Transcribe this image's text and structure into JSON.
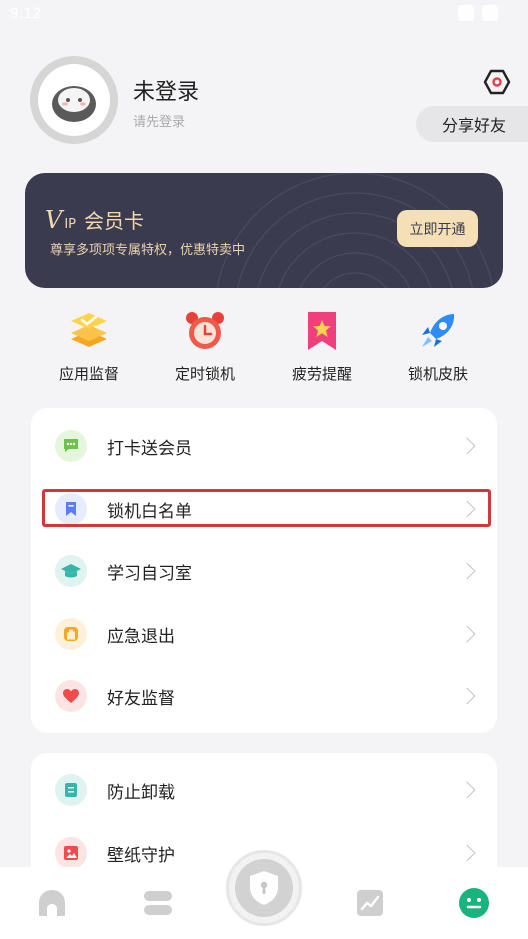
{
  "status_bar": {
    "time": "9:12"
  },
  "profile": {
    "name": "未登录",
    "subtitle": "请先登录",
    "share_label": "分享好友"
  },
  "vip": {
    "v_letter": "V",
    "ip_letters": "IP",
    "title": "会员卡",
    "description": "尊享多项项专属特权，优惠特卖中",
    "button_label": "立即开通"
  },
  "quick_actions": [
    {
      "label": "应用监督",
      "icon": "layers-icon"
    },
    {
      "label": "定时锁机",
      "icon": "alarm-clock-icon"
    },
    {
      "label": "疲劳提醒",
      "icon": "bookmark-star-icon"
    },
    {
      "label": "锁机皮肤",
      "icon": "rocket-icon"
    }
  ],
  "menu_group_1": [
    {
      "label": "打卡送会员",
      "icon": "chat-icon",
      "color": "#6cc24a"
    },
    {
      "label": "锁机白名单",
      "icon": "bookmark-icon",
      "color": "#5b7cf2"
    },
    {
      "label": "学习自习室",
      "icon": "graduation-cap-icon",
      "color": "#36b5a8"
    },
    {
      "label": "应急退出",
      "icon": "hand-icon",
      "color": "#f5a623"
    },
    {
      "label": "好友监督",
      "icon": "heart-icon",
      "color": "#ef4b4b"
    }
  ],
  "menu_group_2": [
    {
      "label": "防止卸载",
      "icon": "document-icon",
      "color": "#36b5a8"
    },
    {
      "label": "壁纸守护",
      "icon": "image-icon",
      "color": "#ef4b4b"
    }
  ],
  "colors": {
    "vip_bg": "#3b3b50",
    "vip_gold": "#f1d8ad",
    "highlight": "#d4373a",
    "accent_green": "#19b47e"
  }
}
